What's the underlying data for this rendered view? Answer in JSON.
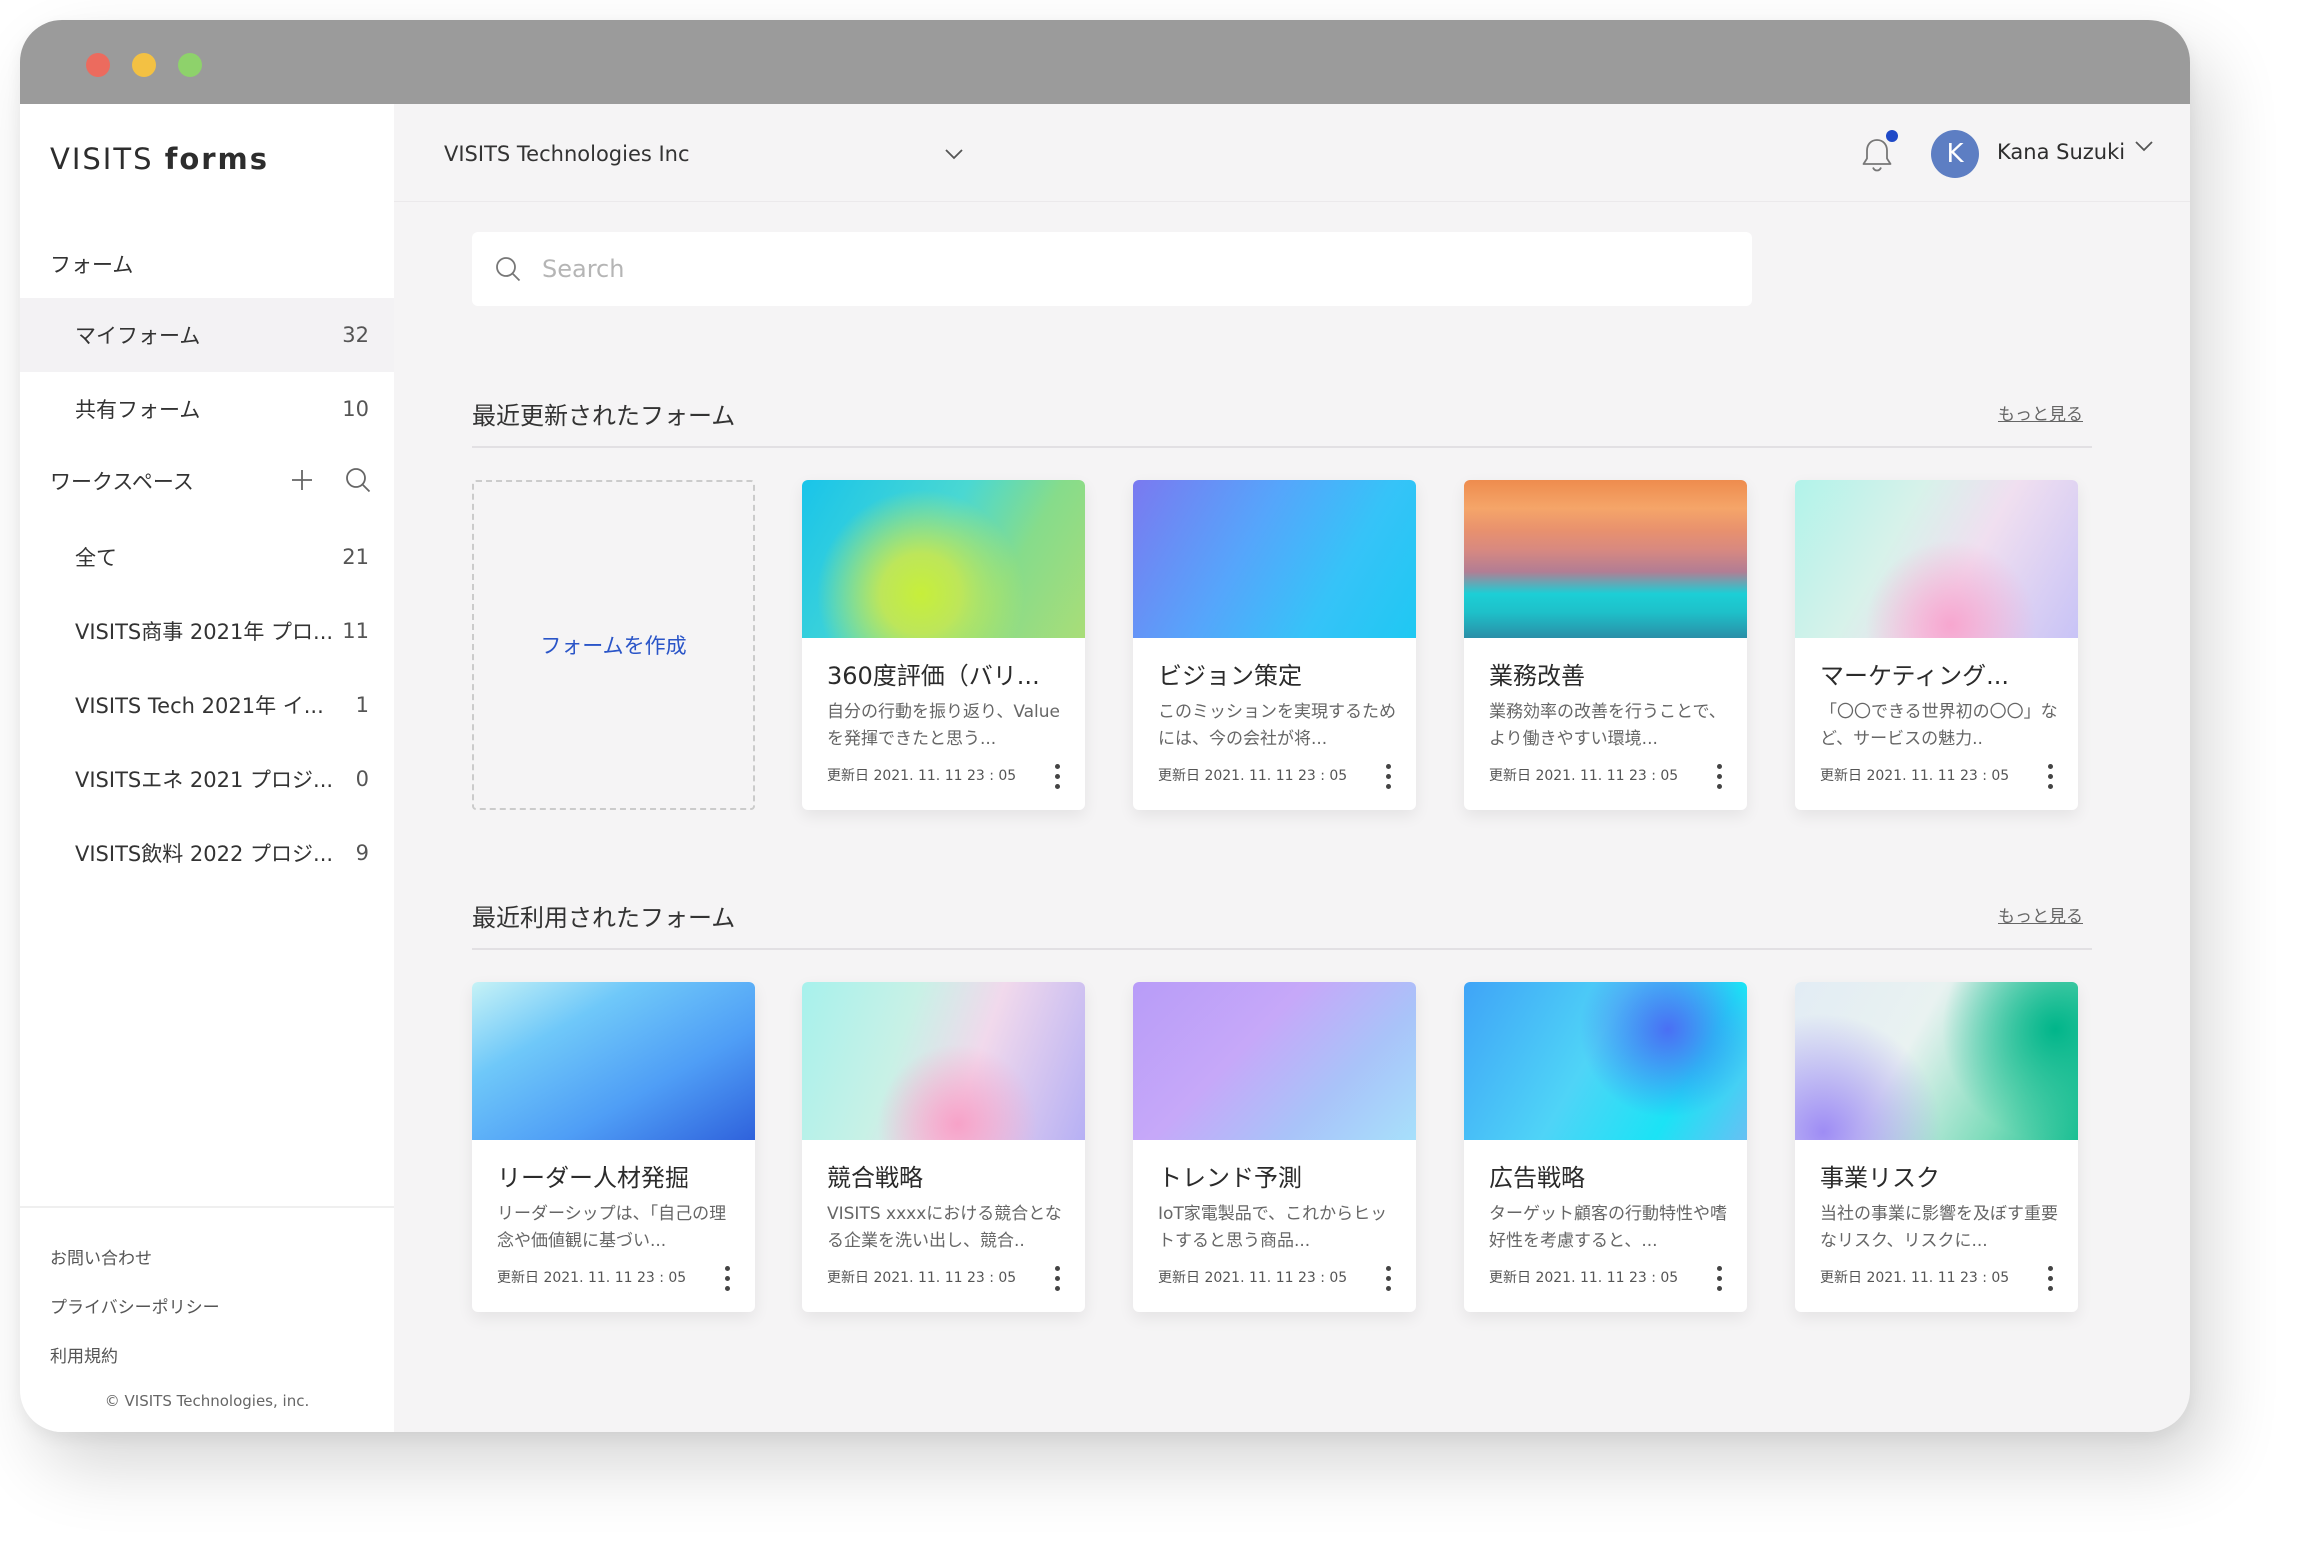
{
  "window": {
    "traffic_lights": [
      "#ec6b5e",
      "#f3c143",
      "#8ed26b"
    ]
  },
  "sidebar": {
    "logo_main": "VISITS",
    "logo_sub": "forms",
    "forms_heading": "フォーム",
    "form_items": [
      {
        "label": "マイフォーム",
        "count": "32",
        "active": true
      },
      {
        "label": "共有フォーム",
        "count": "10",
        "active": false
      }
    ],
    "workspace_heading": "ワークスペース",
    "workspace_items": [
      {
        "label": "全て",
        "count": "21"
      },
      {
        "label": "VISITS商事 2021年 プロ...",
        "count": "11"
      },
      {
        "label": "VISITS Tech 2021年 イ...",
        "count": "1"
      },
      {
        "label": "VISITSエネ 2021 プロジ...",
        "count": "0"
      },
      {
        "label": "VISITS飲料 2022 プロジ...",
        "count": "9"
      }
    ],
    "footer_links": [
      "お問い合わせ",
      "プライバシーポリシー",
      "利用規約"
    ],
    "copyright": "© VISITS Technologies, inc."
  },
  "topbar": {
    "organization": "VISITS Technologies Inc",
    "user_initial": "K",
    "user_name": "Kana Suzuki",
    "notification_dot_color": "#1f49c7"
  },
  "search": {
    "placeholder": "Search"
  },
  "recent_updated": {
    "title": "最近更新されたフォーム",
    "more": "もっと見る",
    "create_label": "フォームを作成",
    "cards": [
      {
        "title": "360度評価（バリ...",
        "desc": "自分の行動を振り返り、Valueを発揮できたと思う...",
        "date": "更新日 2021. 11. 11  23 : 05"
      },
      {
        "title": "ビジョン策定",
        "desc": "このミッションを実現するためには、今の会社が将...",
        "date": "更新日 2021. 11. 11  23 : 05"
      },
      {
        "title": "業務改善",
        "desc": "業務効率の改善を行うことで、より働きやすい環境...",
        "date": "更新日 2021. 11. 11  23 : 05"
      },
      {
        "title": "マーケティング...",
        "desc": "「〇〇できる世界初の〇〇」など、サービスの魅力..",
        "date": "更新日 2021. 11. 11  23 : 05"
      }
    ]
  },
  "recent_used": {
    "title": "最近利用されたフォーム",
    "more": "もっと見る",
    "cards": [
      {
        "title": "リーダー人材発掘",
        "desc": "リーダーシップは、「自己の理念や価値観に基づい...",
        "date": "更新日 2021. 11. 11  23 : 05"
      },
      {
        "title": "競合戦略",
        "desc": "VISITS xxxxにおける競合となる企業を洗い出し、競合..",
        "date": "更新日 2021. 11. 11  23 : 05"
      },
      {
        "title": "トレンド予測",
        "desc": "IoT家電製品で、これからヒットすると思う商品...",
        "date": "更新日 2021. 11. 11  23 : 05"
      },
      {
        "title": "広告戦略",
        "desc": "ターゲット顧客の行動特性や嗜好性を考慮すると、...",
        "date": "更新日 2021. 11. 11  23 : 05"
      },
      {
        "title": "事業リスク",
        "desc": "当社の事業に影響を及ぼす重要なリスク、リスクに...",
        "date": "更新日 2021. 11. 11  23 : 05"
      }
    ]
  }
}
